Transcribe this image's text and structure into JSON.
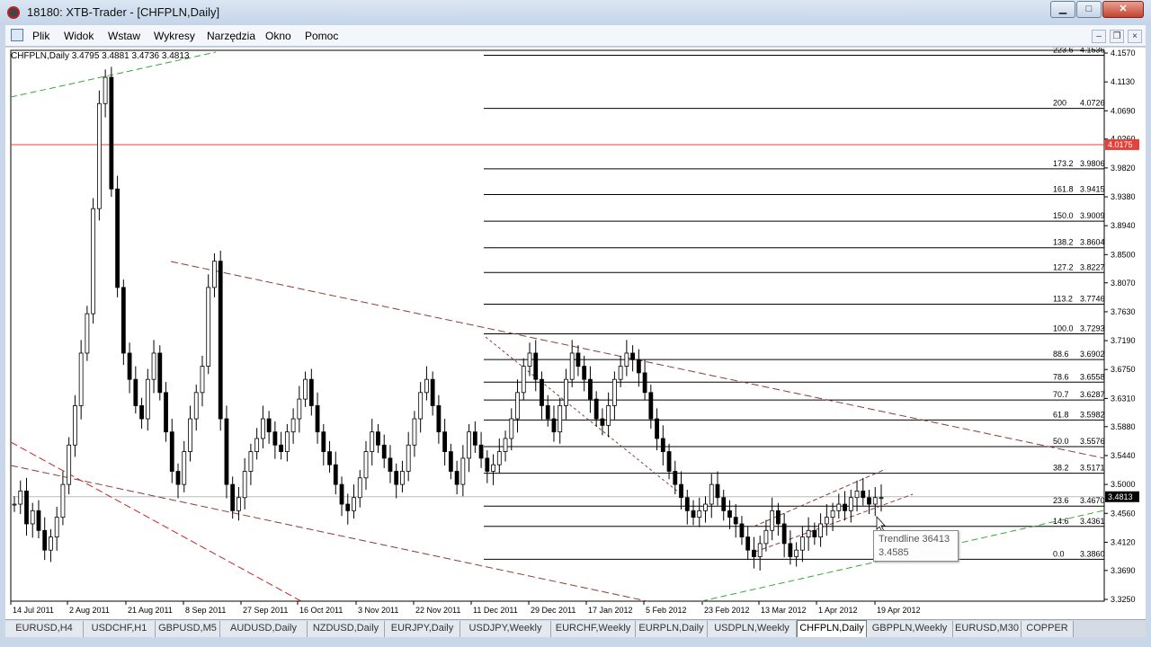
{
  "window": {
    "title": "18180: XTB-Trader - [CHFPLN,Daily]",
    "min": "▁",
    "max": "□",
    "close": "✕"
  },
  "menu": [
    "Plik",
    "Widok",
    "Wstaw",
    "Wykresy",
    "Narzędzia",
    "Okno",
    "Pomoc"
  ],
  "mdi_controls": [
    "–",
    "❐",
    "×"
  ],
  "chart": {
    "info": "CHFPLN,Daily  3.4795 3.4881 3.4736 3.4813",
    "current_price": "3.4813",
    "hline_price": "4.0175",
    "price_axis": [
      "4.1570",
      "4.1130",
      "4.0690",
      "4.0260",
      "3.9820",
      "3.9380",
      "3.8940",
      "3.8500",
      "3.8070",
      "3.7630",
      "3.7190",
      "3.6750",
      "3.6310",
      "3.5880",
      "3.5440",
      "3.5000",
      "3.4560",
      "3.4120",
      "3.3690",
      "3.3250"
    ],
    "date_axis": [
      "14 Jul 2011",
      "2 Aug 2011",
      "21 Aug 2011",
      "8 Sep 2011",
      "27 Sep 2011",
      "16 Oct 2011",
      "3 Nov 2011",
      "22 Nov 2011",
      "11 Dec 2011",
      "29 Dec 2011",
      "17 Jan 2012",
      "5 Feb 2012",
      "23 Feb 2012",
      "13 Mar 2012",
      "1 Apr 2012",
      "19 Apr 2012"
    ],
    "fib_levels": [
      {
        "level": "223.6",
        "price": "4.1536"
      },
      {
        "level": "200",
        "price": "4.0726"
      },
      {
        "level": "173.2",
        "price": "3.9806"
      },
      {
        "level": "161.8",
        "price": "3.9415"
      },
      {
        "level": "150.0",
        "price": "3.9009"
      },
      {
        "level": "138.2",
        "price": "3.8604"
      },
      {
        "level": "127.2",
        "price": "3.8227"
      },
      {
        "level": "113.2",
        "price": "3.7746"
      },
      {
        "level": "100.0",
        "price": "3.7293"
      },
      {
        "level": "88.6",
        "price": "3.6902"
      },
      {
        "level": "78.6",
        "price": "3.6558"
      },
      {
        "level": "70.7",
        "price": "3.6287"
      },
      {
        "level": "61.8",
        "price": "3.5982"
      },
      {
        "level": "50.0",
        "price": "3.5576"
      },
      {
        "level": "38.2",
        "price": "3.5171"
      },
      {
        "level": "23.6",
        "price": "3.4670"
      },
      {
        "level": "14.6",
        "price": "3.4361"
      },
      {
        "level": "0.0",
        "price": "3.3860"
      }
    ],
    "tooltip_title": "Trendline 36413",
    "tooltip_value": "3.4585"
  },
  "tabs": [
    "EURUSD,H4",
    "USDCHF,H1",
    "GBPUSD,M5",
    "AUDUSD,Daily",
    "NZDUSD,Daily",
    "EURJPY,Daily",
    "USDJPY,Weekly",
    "EURCHF,Weekly",
    "EURPLN,Daily",
    "USDPLN,Weekly",
    "CHFPLN,Daily",
    "GBPPLN,Weekly",
    "EURUSD,M30",
    "COPPER"
  ],
  "active_tab": "CHFPLN,Daily",
  "colors": {
    "hline": "#e8413a",
    "price_label_bg": "#e8413a",
    "current_label_bg": "#000000",
    "fib": "#000000",
    "trend_dark": "#8c3a3a",
    "trend_green": "#33aa33",
    "trend_red": "#cc2222"
  }
}
